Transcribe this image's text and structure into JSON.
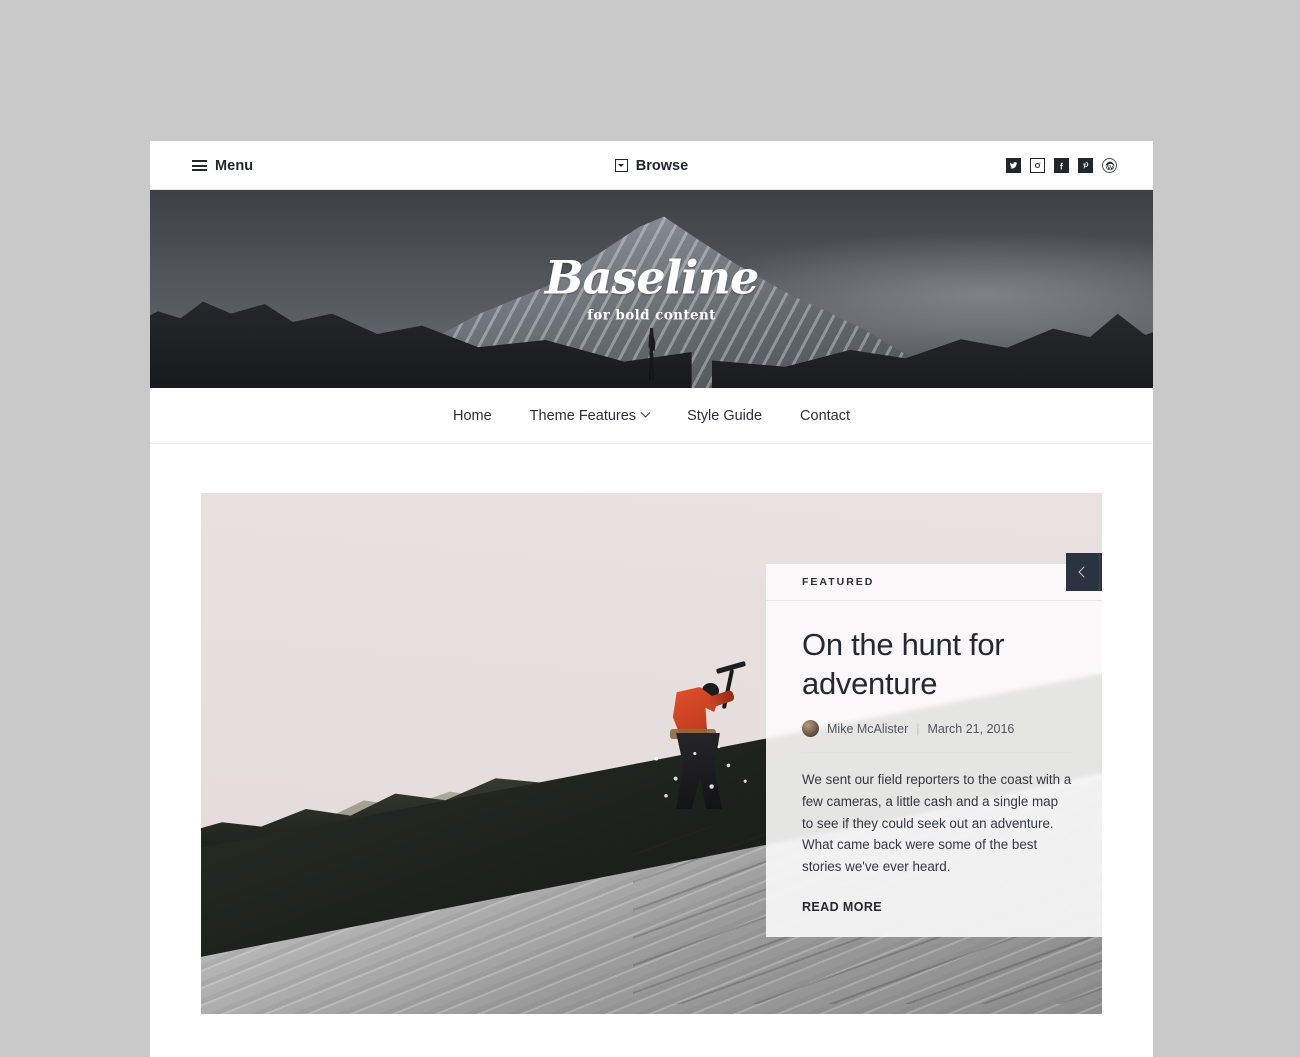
{
  "topbar": {
    "menu_label": "Menu",
    "menu_icon": "hamburger-icon",
    "browse_label": "Browse",
    "browse_icon": "browse-box-icon",
    "social": [
      {
        "name": "twitter",
        "glyph": "t"
      },
      {
        "name": "instagram",
        "glyph": "o"
      },
      {
        "name": "facebook",
        "glyph": "f"
      },
      {
        "name": "pinterest",
        "glyph": "p"
      },
      {
        "name": "wordpress",
        "glyph": "W"
      }
    ]
  },
  "banner": {
    "logo_text": "Baseline",
    "tagline": "for bold content"
  },
  "nav": {
    "items": [
      {
        "label": "Home",
        "has_dropdown": false
      },
      {
        "label": "Theme Features",
        "has_dropdown": true
      },
      {
        "label": "Style Guide",
        "has_dropdown": false
      },
      {
        "label": "Contact",
        "has_dropdown": false
      }
    ]
  },
  "featured": {
    "eyebrow": "FEATURED",
    "title": "On the hunt for adventure",
    "author": "Mike McAlister",
    "separator": "|",
    "date": "March 21, 2016",
    "excerpt": "We sent our field reporters to the coast with a few cameras, a little cash and a single map to see if they could seek out an adventure. What came back were some of the best stories we've ever heard.",
    "read_more": "READ MORE",
    "prev_icon": "chevron-left-icon",
    "next_icon": "chevron-right-icon"
  },
  "colors": {
    "accent_dark": "#2b3240",
    "text": "#26292e",
    "page_bg": "#ffffff",
    "desktop_bg": "#c9c9c9"
  }
}
